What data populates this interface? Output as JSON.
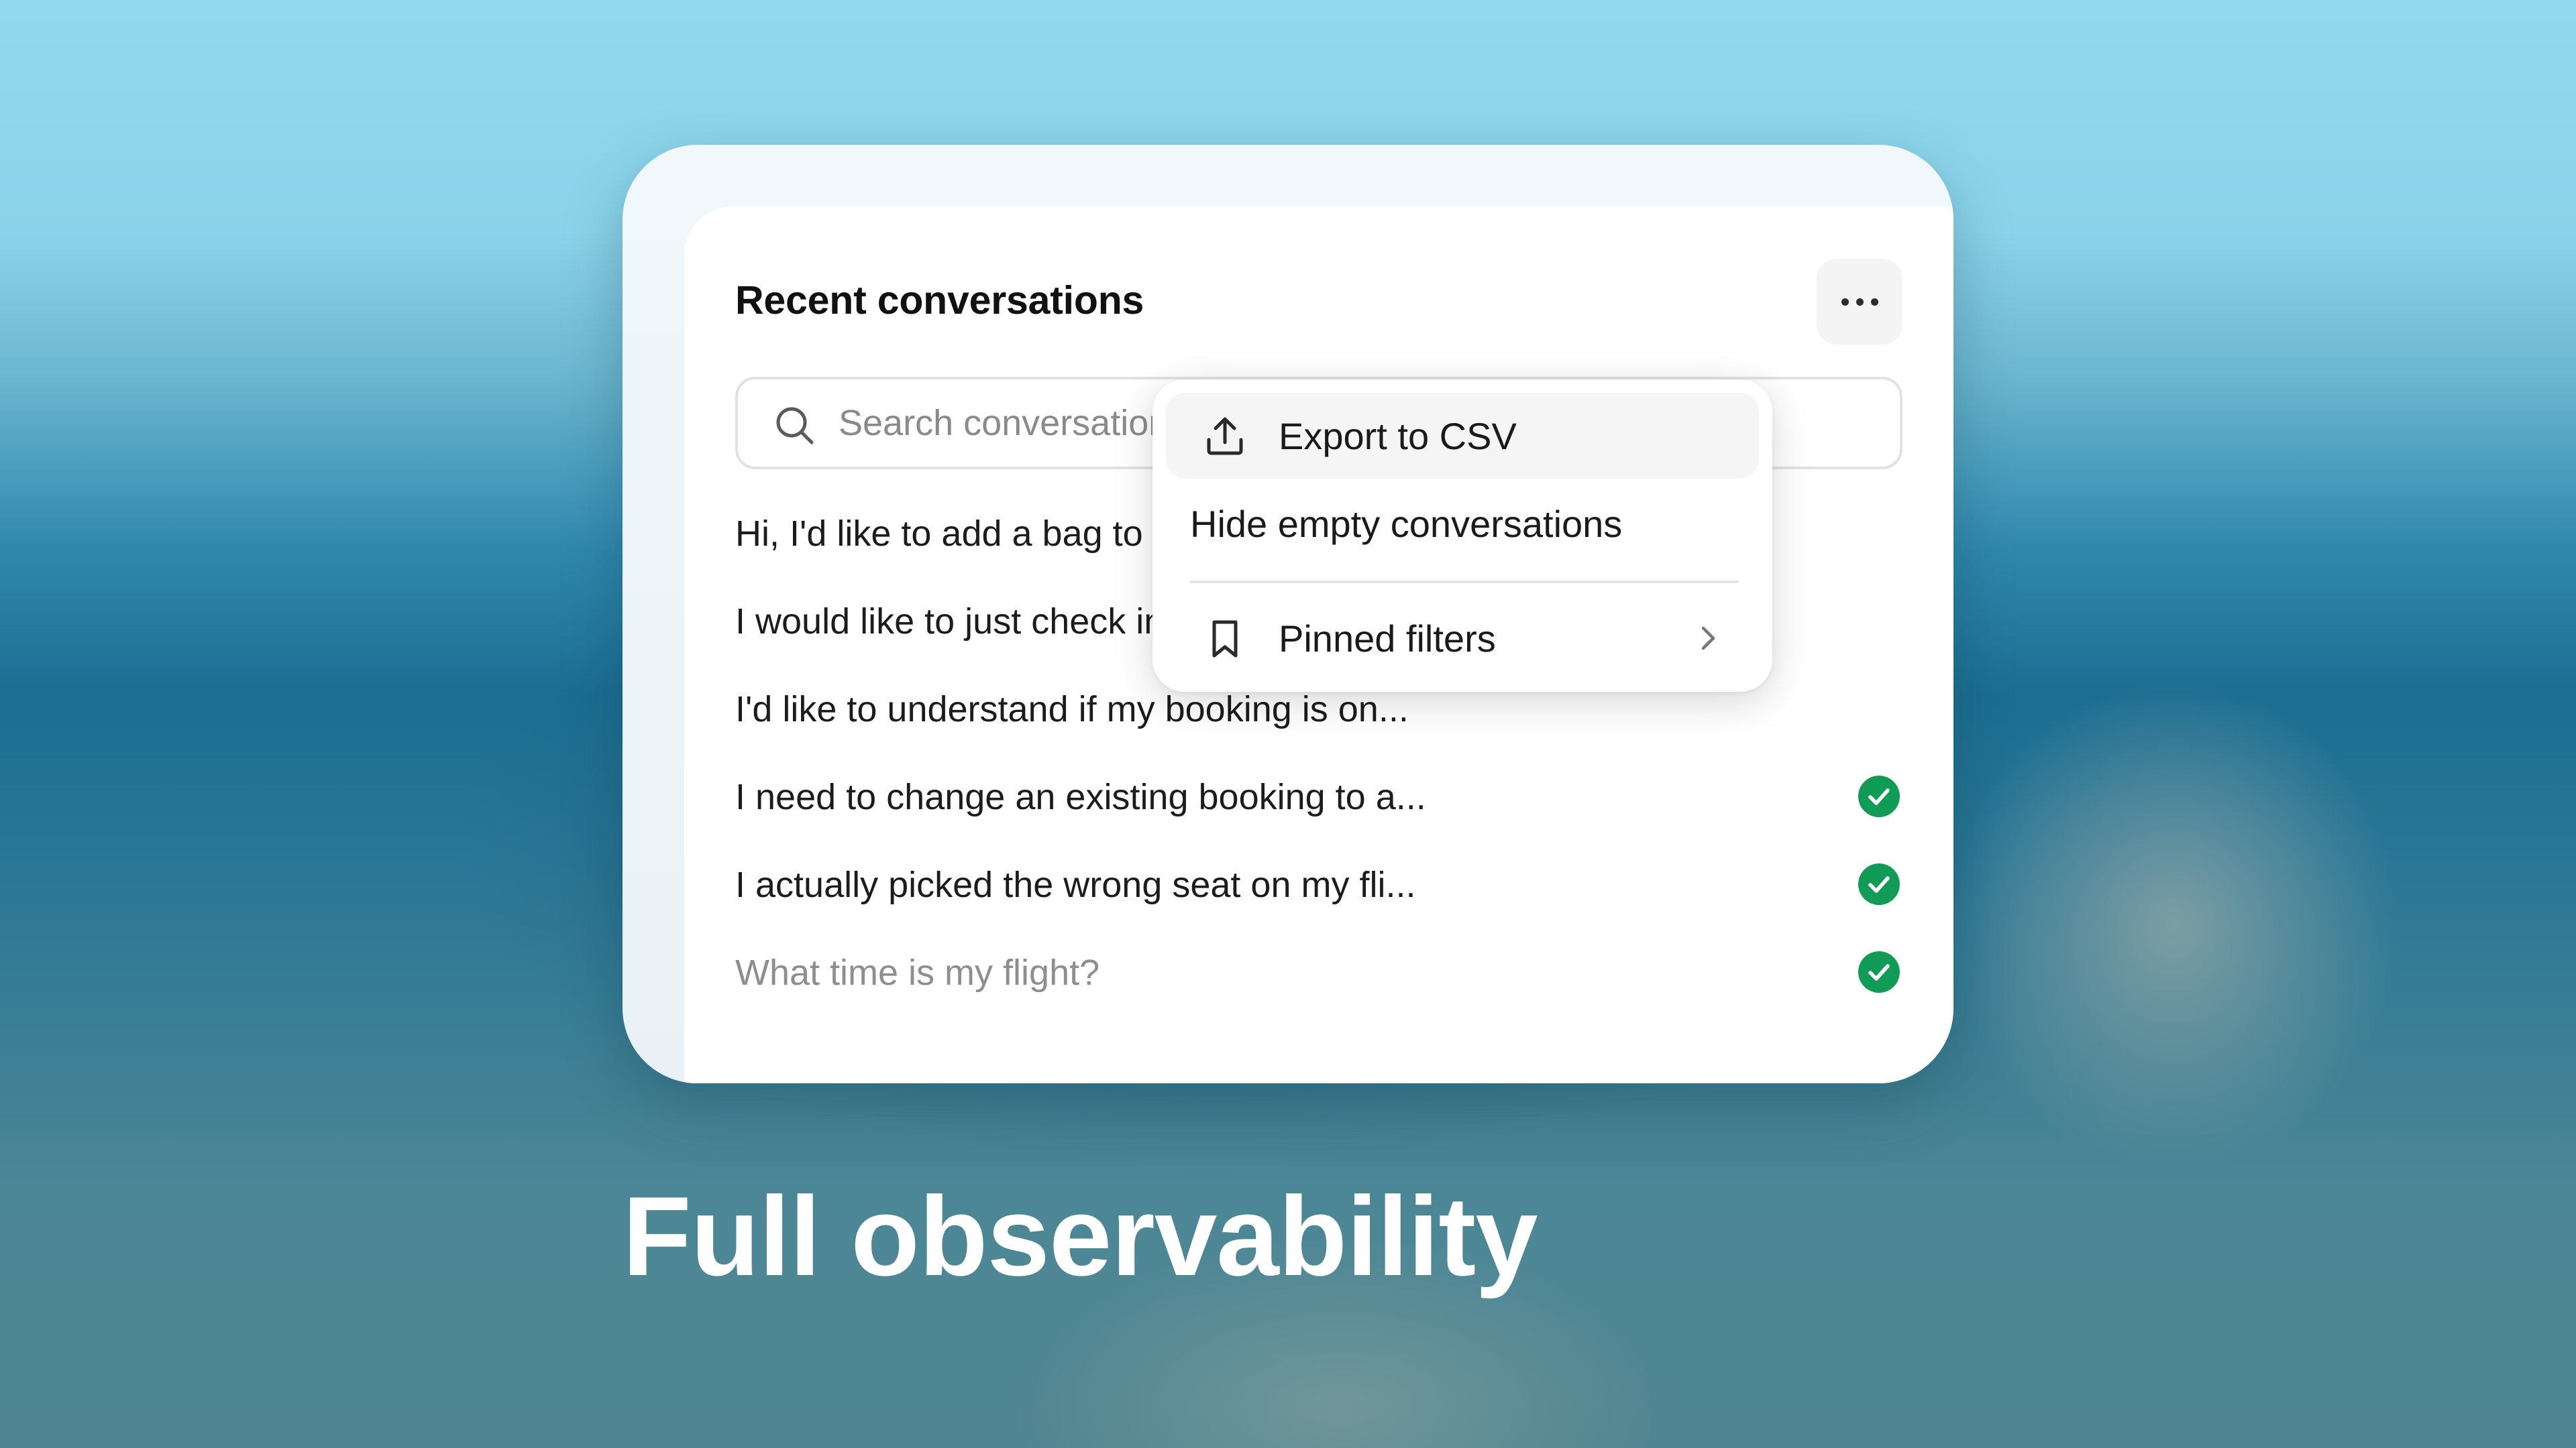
{
  "card": {
    "title": "Recent conversations",
    "more_icon": "more-horizontal-icon",
    "search": {
      "placeholder": "Search conversations",
      "value": "",
      "icon": "search-icon"
    },
    "conversations": [
      {
        "text": "Hi, I'd like to add a bag to my booking",
        "status": ""
      },
      {
        "text": "I would like to just check in for my flight",
        "status": ""
      },
      {
        "text": "I'd like to understand if my booking is on...",
        "status": ""
      },
      {
        "text": "I need to change an existing booking to a...",
        "status": "resolved"
      },
      {
        "text": "I actually picked the wrong seat on my fli...",
        "status": "resolved"
      },
      {
        "text": "What time is my flight?",
        "status": "resolved"
      }
    ]
  },
  "dropdown": {
    "items": [
      {
        "label": "Export to CSV",
        "icon": "upload-icon"
      },
      {
        "label": "Hide empty conversations",
        "icon": ""
      },
      {
        "label": "Pinned filters",
        "icon": "bookmark-icon",
        "submenu_icon": "chevron-right-icon"
      }
    ]
  },
  "headline": "Full observability",
  "colors": {
    "resolved_green": "#129a57",
    "background_top": "#92d8ee",
    "background_mid": "#1c6e92"
  }
}
